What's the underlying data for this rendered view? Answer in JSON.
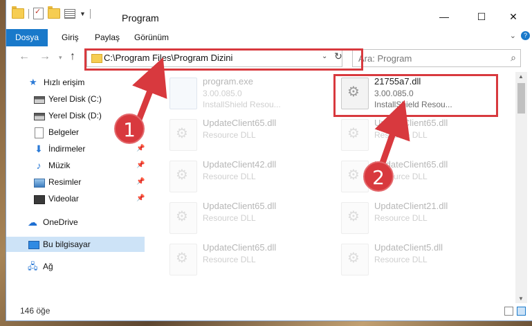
{
  "window": {
    "title": "Program",
    "minimize": "—",
    "maximize": "☐",
    "close": "✕"
  },
  "ribbon": {
    "tabs": [
      "Dosya",
      "Giriş",
      "Paylaş",
      "Görünüm"
    ]
  },
  "navigation": {
    "back_icon": "left-arrow-icon",
    "address_path": "C:\\Program Files\\Program Dizini",
    "search_placeholder": "Ara: Program"
  },
  "sidebar": {
    "items": [
      {
        "label": "Hızlı erişim",
        "icon": "star-icon",
        "pinned": false
      },
      {
        "label": "Yerel Disk (C:)",
        "icon": "drive-icon",
        "pinned": false
      },
      {
        "label": "Yerel Disk (D:)",
        "icon": "drive-icon",
        "pinned": false
      },
      {
        "label": "Belgeler",
        "icon": "documents-icon",
        "pinned": false
      },
      {
        "label": "İndirmeler",
        "icon": "download-icon",
        "pinned": true
      },
      {
        "label": "Müzik",
        "icon": "music-icon",
        "pinned": true
      },
      {
        "label": "Resimler",
        "icon": "pictures-icon",
        "pinned": true
      },
      {
        "label": "Videolar",
        "icon": "videos-icon",
        "pinned": true
      },
      {
        "label": "OneDrive",
        "icon": "cloud-icon",
        "pinned": false
      },
      {
        "label": "Bu bilgisayar",
        "icon": "computer-icon",
        "pinned": false,
        "selected": true
      },
      {
        "label": "Ağ",
        "icon": "network-icon",
        "pinned": false
      }
    ]
  },
  "files": [
    {
      "name": "program.exe",
      "line1": "3.00.085.0",
      "line2": "InstallShield Resou...",
      "type": "exe",
      "highlighted": false
    },
    {
      "name": "21755a7.dll",
      "line1": "3.00.085.0",
      "line2": "InstallShield Resou...",
      "type": "dll",
      "highlighted": true
    },
    {
      "name": "UpdateClient65.dll",
      "line1": "Resource DLL",
      "type": "dll"
    },
    {
      "name": "UpdateClient65.dll",
      "line1": "Resource DLL",
      "type": "dll"
    },
    {
      "name": "UpdateClient42.dll",
      "line1": "Resource DLL",
      "type": "dll"
    },
    {
      "name": "UpdateClient65.dll",
      "line1": "Resource DLL",
      "type": "dll"
    },
    {
      "name": "UpdateClient65.dll",
      "line1": "Resource DLL",
      "type": "dll"
    },
    {
      "name": "UpdateClient21.dll",
      "line1": "Resource DLL",
      "type": "dll"
    },
    {
      "name": "UpdateClient65.dll",
      "line1": "Resource DLL",
      "type": "dll"
    },
    {
      "name": "UpdateClient5.dll",
      "line1": "Resource DLL",
      "type": "dll"
    }
  ],
  "status": {
    "item_count": "146 öğe"
  },
  "annotations": {
    "marker1": "1",
    "marker2": "2",
    "color": "#d8393e"
  }
}
